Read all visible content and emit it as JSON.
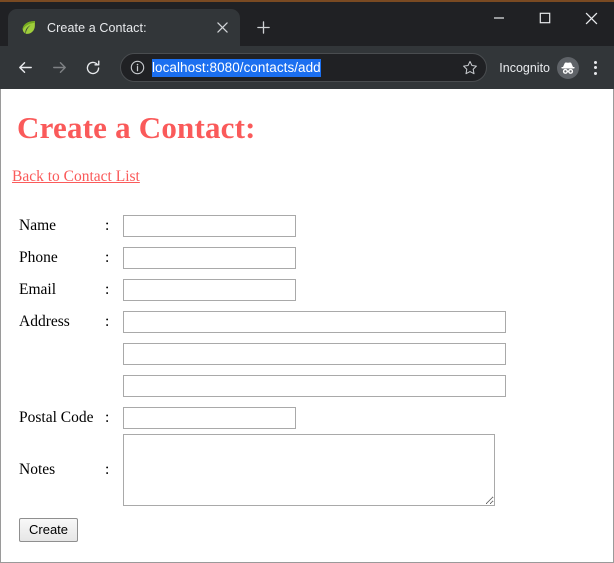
{
  "browser": {
    "tab": {
      "title": "Create a Contact:",
      "favicon_icon": "spring-leaf-icon",
      "close_icon": "close-icon"
    },
    "new_tab_icon": "plus-icon",
    "window_controls": {
      "minimize_icon": "minimize-icon",
      "maximize_icon": "maximize-icon",
      "close_icon": "close-icon"
    },
    "toolbar": {
      "back_icon": "back-arrow-icon",
      "forward_icon": "forward-arrow-icon",
      "reload_icon": "reload-icon",
      "site_info_icon": "info-circle-icon",
      "url": "localhost:8080/contacts/add",
      "url_selected": true,
      "bookmark_icon": "star-icon",
      "incognito_label": "Incognito",
      "incognito_icon": "incognito-hat-icon",
      "menu_icon": "three-dots-menu-icon"
    }
  },
  "page": {
    "heading": "Create a Contact:",
    "back_link": "Back to Contact List",
    "colon": ":",
    "fields": [
      {
        "label": "Name",
        "value": "",
        "type": "text",
        "size": "short"
      },
      {
        "label": "Phone",
        "value": "",
        "type": "text",
        "size": "short"
      },
      {
        "label": "Email",
        "value": "",
        "type": "text",
        "size": "short"
      },
      {
        "label": "Address",
        "value": "",
        "type": "text",
        "size": "long"
      },
      {
        "label": "",
        "value": "",
        "type": "text",
        "size": "long"
      },
      {
        "label": "",
        "value": "",
        "type": "text",
        "size": "long"
      },
      {
        "label": "Postal Code",
        "value": "",
        "type": "text",
        "size": "short"
      },
      {
        "label": "Notes",
        "value": "",
        "type": "textarea",
        "size": "area"
      }
    ],
    "submit_label": "Create"
  },
  "colors": {
    "heading": "#fa5a5a",
    "link": "#fa5a5a",
    "chrome_bg": "#323639",
    "tabstrip_bg": "#202124",
    "url_highlight": "#1b6ff0",
    "top_accent": "#7a4a22"
  }
}
